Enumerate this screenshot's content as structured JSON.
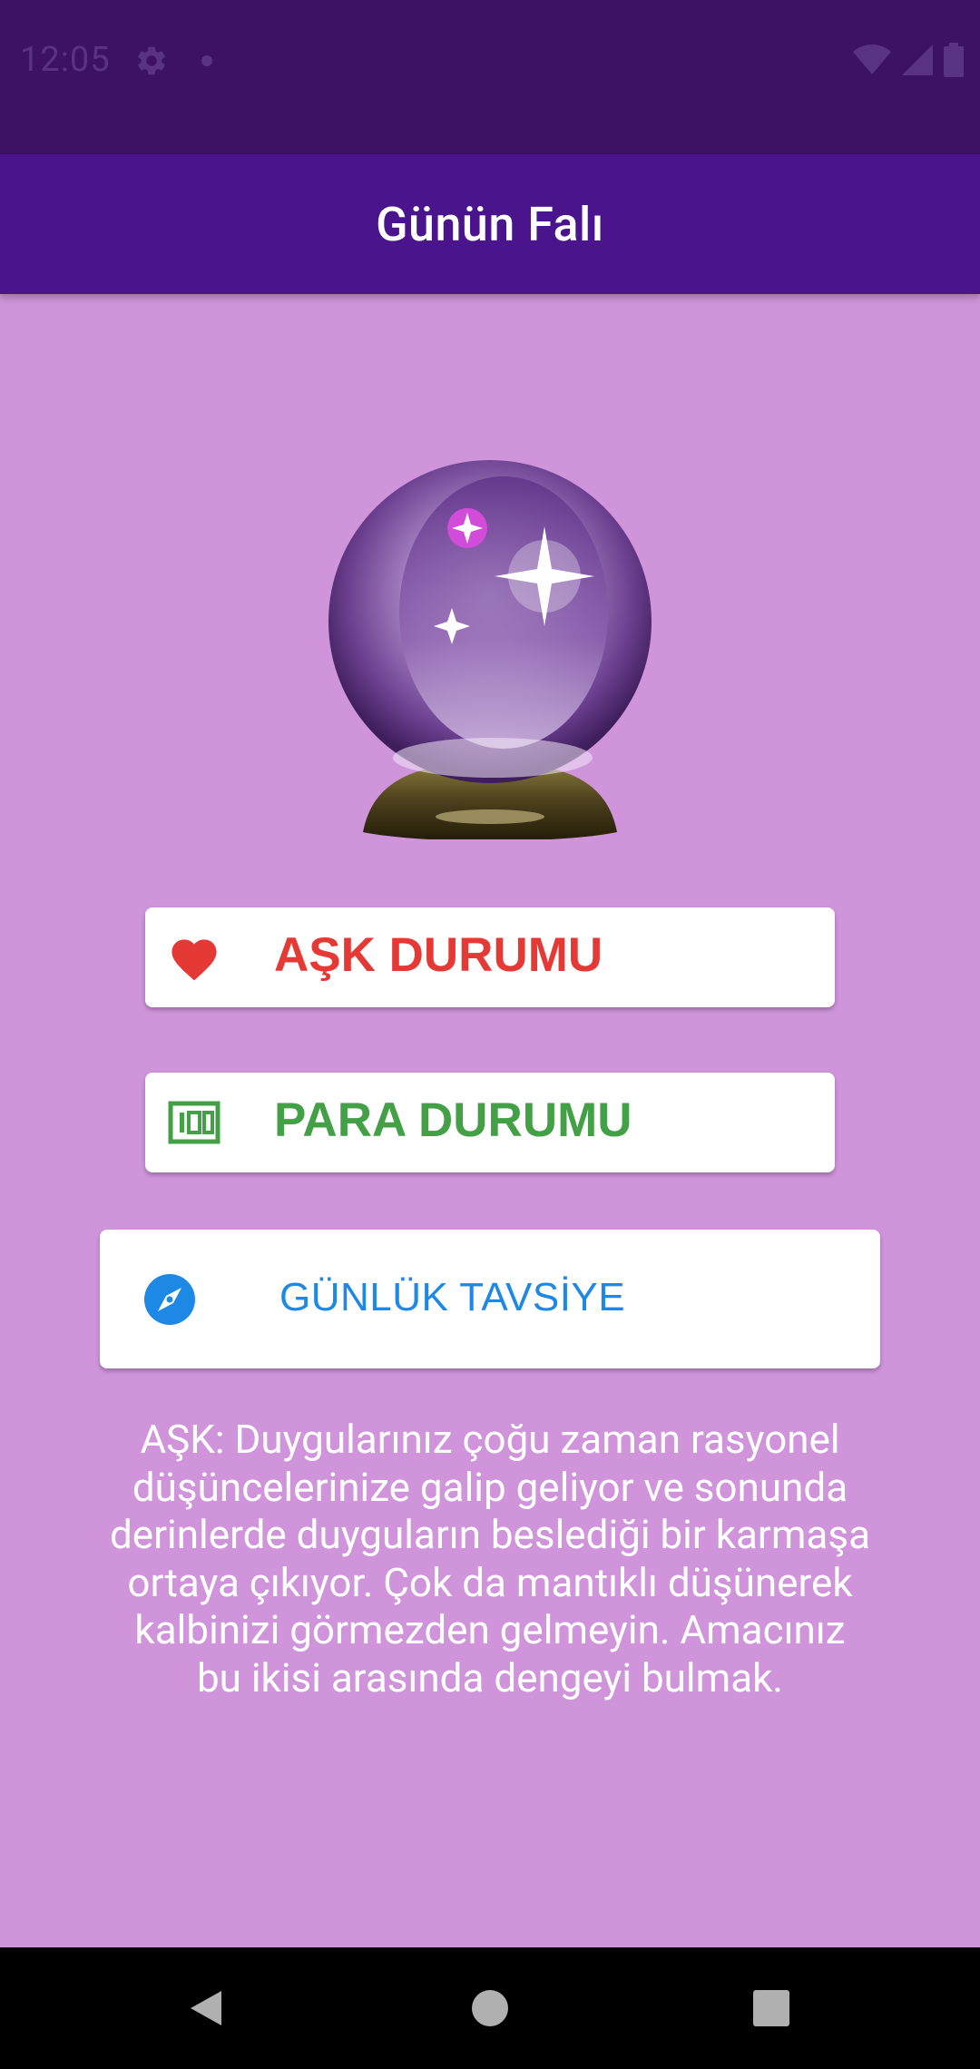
{
  "status_bar": {
    "time": "12:05"
  },
  "app_bar": {
    "title": "Günün Falı"
  },
  "buttons": {
    "love": {
      "label": "AŞK DURUMU",
      "icon": "heart-icon",
      "color": "#E53935"
    },
    "money": {
      "label": "PARA DURUMU",
      "icon": "money-icon",
      "color": "#43A047"
    },
    "advice": {
      "label": "GÜNLÜK TAVSİYE",
      "icon": "compass-icon",
      "color": "#1E88E5"
    }
  },
  "fortune": {
    "text": "AŞK: Duygularınız çoğu zaman rasyonel düşüncelerinize galip geliyor ve sonunda derinlerde duyguların beslediği bir karmaşa ortaya çıkıyor. Çok da mantıklı düşünerek kalbinizi görmezden gelmeyin. Amacınız bu ikisi arasında dengeyi bulmak."
  },
  "colors": {
    "status_bar": "#3C1166",
    "app_bar": "#4A148C",
    "background": "#CF94DA"
  }
}
